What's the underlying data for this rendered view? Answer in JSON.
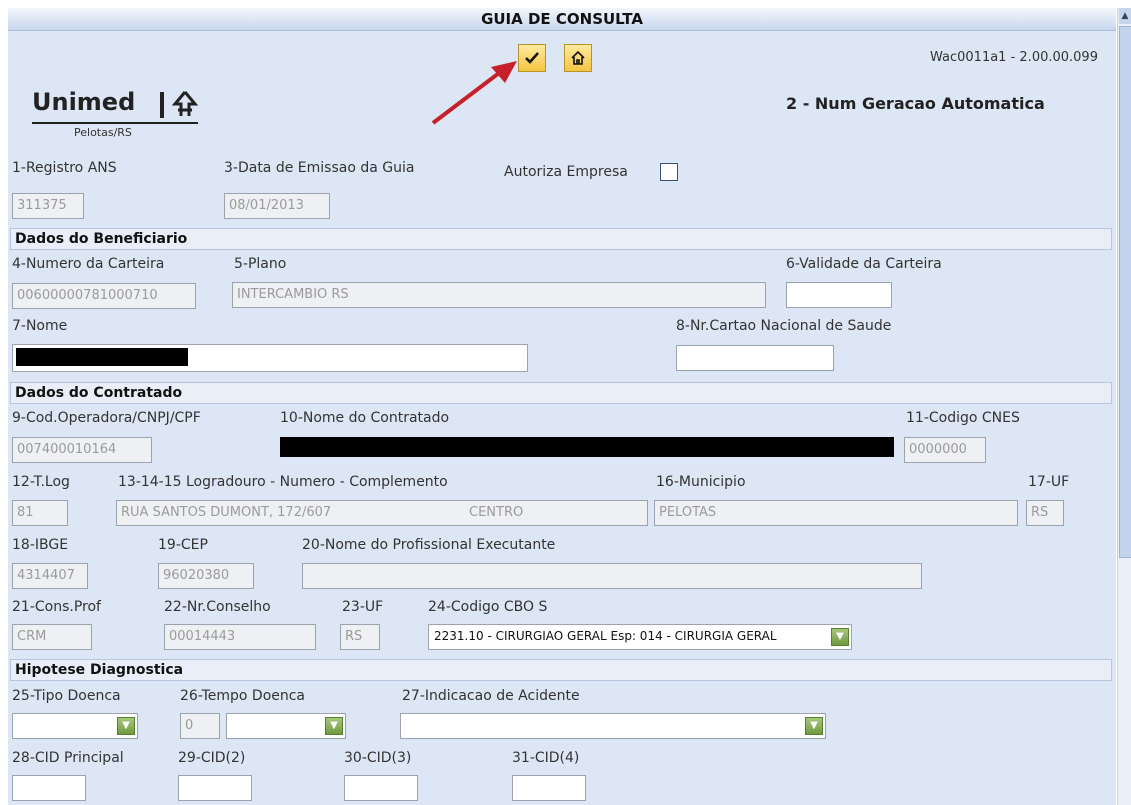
{
  "window": {
    "title": "GUIA DE CONSULTA",
    "version": "Wac0011a1 - 2.00.00.099",
    "mode": "2 - Num Geracao Automatica"
  },
  "toolbar": {
    "confirm_icon": "checkmark-icon",
    "home_icon": "home-icon"
  },
  "logo": {
    "name": "Unimed",
    "city": "Pelotas/RS"
  },
  "header_fields": {
    "registro_label": "1-Registro ANS",
    "registro_value": "311375",
    "data_label": "3-Data de Emissao da Guia",
    "data_value": "08/01/2013",
    "autoriza_label": "Autoriza Empresa"
  },
  "beneficiario": {
    "section": "Dados do Beneficiario",
    "carteira_label": "4-Numero da Carteira",
    "carteira_value": "00600000781000710",
    "plano_label": "5-Plano",
    "plano_value": "INTERCAMBIO RS",
    "validade_label": "6-Validade da Carteira",
    "validade_value": "",
    "nome_label": "7-Nome",
    "cns_label": "8-Nr.Cartao Nacional de Saude",
    "cns_value": ""
  },
  "contratado": {
    "section": "Dados do Contratado",
    "cod_label": "9-Cod.Operadora/CNPJ/CPF",
    "cod_value": "007400010164",
    "nome_label": "10-Nome do Contratado",
    "cnes_label": "11-Codigo CNES",
    "cnes_value": "0000000",
    "tlog_label": "12-T.Log",
    "tlog_value": "81",
    "logradouro_label": "13-14-15 Logradouro - Numero - Complemento",
    "logradouro_value": "RUA SANTOS DUMONT, 172/607",
    "complemento_value": "CENTRO",
    "municipio_label": "16-Municipio",
    "municipio_value": "PELOTAS",
    "uf_label": "17-UF",
    "uf_value": "RS",
    "ibge_label": "18-IBGE",
    "ibge_value": "4314407",
    "cep_label": "19-CEP",
    "cep_value": "96020380",
    "profissional_label": "20-Nome do Profissional Executante",
    "profissional_value": "",
    "cons_label": "21-Cons.Prof",
    "cons_value": "CRM",
    "conselho_label": "22-Nr.Conselho",
    "conselho_value": "00014443",
    "uf2_label": "23-UF",
    "uf2_value": "RS",
    "cbo_label": "24-Codigo CBO S",
    "cbo_value": "2231.10 - CIRURGIAO GERAL Esp: 014 - CIRURGIA GERAL"
  },
  "diagnostico": {
    "section": "Hipotese Diagnostica",
    "tipo_label": "25-Tipo Doenca",
    "tipo_value": "",
    "tempo_label": "26-Tempo Doenca",
    "tempo_value": "0",
    "acidente_label": "27-Indicacao de Acidente",
    "acidente_value": "",
    "cid1_label": "28-CID Principal",
    "cid2_label": "29-CID(2)",
    "cid3_label": "30-CID(3)",
    "cid4_label": "31-CID(4)"
  },
  "colors": {
    "accent_arrow": "#c8202a",
    "panel": "#dde6f4",
    "dropdown": "#7aa346"
  }
}
